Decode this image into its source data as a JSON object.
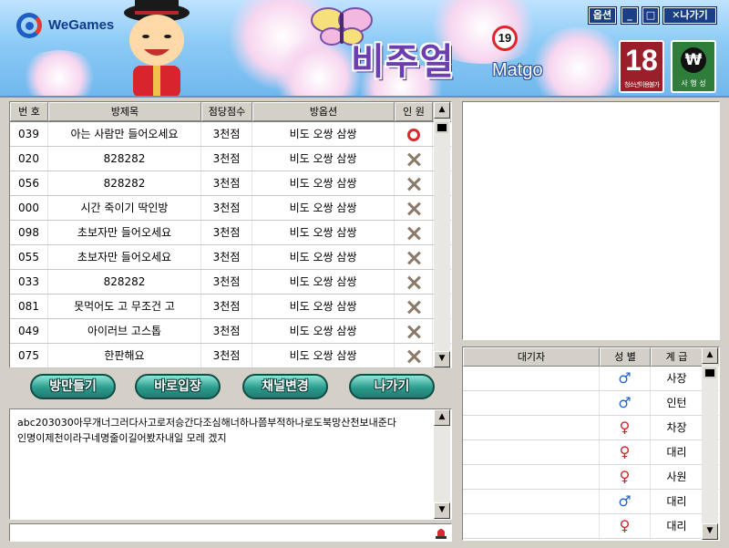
{
  "header": {
    "logo_text": "WeGames",
    "title": "비주얼",
    "subtitle": "Matgo",
    "age_rating": "19",
    "buttons": {
      "options": "옵션",
      "minimize": "_",
      "maximize": "□",
      "exit": "✕나가기"
    },
    "rating_18": {
      "number": "18",
      "caption": "청소년이용불가"
    },
    "rating_gamble": {
      "symbol": "₩",
      "caption": "사 행 성"
    }
  },
  "rooms": {
    "columns": [
      "번 호",
      "방제목",
      "점당점수",
      "방옵션",
      "인 원"
    ],
    "rows": [
      {
        "no": "039",
        "title": "아는 사람만 들어오세요",
        "score": "3천점",
        "option": "비도 오쌍 삼쌍",
        "status": "open"
      },
      {
        "no": "020",
        "title": "828282",
        "score": "3천점",
        "option": "비도 오쌍 삼쌍",
        "status": "full"
      },
      {
        "no": "056",
        "title": "828282",
        "score": "3천점",
        "option": "비도 오쌍 삼쌍",
        "status": "full"
      },
      {
        "no": "000",
        "title": "시간 죽이기 딱인방",
        "score": "3천점",
        "option": "비도 오쌍 삼쌍",
        "status": "full"
      },
      {
        "no": "098",
        "title": "초보자만 들어오세요",
        "score": "3천점",
        "option": "비도 오쌍 삼쌍",
        "status": "full"
      },
      {
        "no": "055",
        "title": "초보자만 들어오세요",
        "score": "3천점",
        "option": "비도 오쌍 삼쌍",
        "status": "full"
      },
      {
        "no": "033",
        "title": "828282",
        "score": "3천점",
        "option": "비도 오쌍 삼쌍",
        "status": "full"
      },
      {
        "no": "081",
        "title": "못먹어도 고 무조건 고",
        "score": "3천점",
        "option": "비도 오쌍 삼쌍",
        "status": "full"
      },
      {
        "no": "049",
        "title": "아이러브 고스톱",
        "score": "3천점",
        "option": "비도 오쌍 삼쌍",
        "status": "full"
      },
      {
        "no": "075",
        "title": "한판해요",
        "score": "3천점",
        "option": "비도 오쌍 삼쌍",
        "status": "full"
      }
    ]
  },
  "actions": {
    "make_room": "방만들기",
    "quick_join": "바로입장",
    "change_channel": "채널변경",
    "exit": "나가기"
  },
  "chat": {
    "lines": [
      "abc203030아무개너그러다사고로저승간다조심해너하나쯤부적하나로도북망산천보내준다",
      "인명이제천이라구네명줄이길어봤자내일 모레 겠지"
    ],
    "input_value": ""
  },
  "waiting": {
    "columns": [
      "대기자",
      "성 별",
      "계 급"
    ],
    "rows": [
      {
        "gender": "male",
        "rank": "사장"
      },
      {
        "gender": "male",
        "rank": "인턴"
      },
      {
        "gender": "female",
        "rank": "차장"
      },
      {
        "gender": "female",
        "rank": "대리"
      },
      {
        "gender": "female",
        "rank": "사원"
      },
      {
        "gender": "male",
        "rank": "대리"
      },
      {
        "gender": "female",
        "rank": "대리"
      }
    ]
  },
  "colors": {
    "male": "#1f62c9",
    "female": "#d0202a",
    "accent": "#1a3f86",
    "button": "#2c9c8e"
  }
}
